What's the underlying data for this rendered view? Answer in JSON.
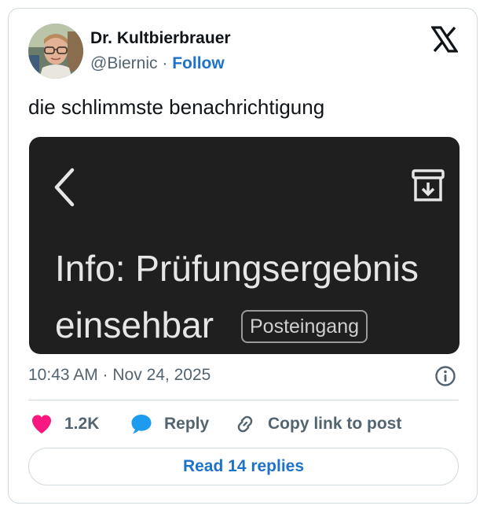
{
  "author": {
    "display_name": "Dr. Kultbierbrauer",
    "handle": "@Biernic",
    "separator": "·",
    "follow_label": "Follow"
  },
  "brand": {
    "logo_icon": "x-logo-icon"
  },
  "tweet": {
    "text": "die schlimmste benachrichtigung"
  },
  "media": {
    "back_icon": "chevron-left-icon",
    "archive_icon": "archive-icon",
    "subject_line1": "Info: Prüfungsergebnis",
    "subject_line2": "einsehbar",
    "label": "Posteingang",
    "background_color": "#1f1f1f"
  },
  "meta": {
    "timestamp": "10:43 AM · Nov 24, 2025",
    "info_icon": "info-icon"
  },
  "actions": {
    "like_count": "1.2K",
    "like_icon": "heart-icon",
    "reply_label": "Reply",
    "reply_icon": "speech-bubble-icon",
    "copy_label": "Copy link to post",
    "copy_icon": "link-icon"
  },
  "read_replies_label": "Read 14 replies",
  "colors": {
    "accent": "#1d72c9",
    "like": "#f91880",
    "reply": "#1d9bf0",
    "muted_text": "#536471"
  }
}
